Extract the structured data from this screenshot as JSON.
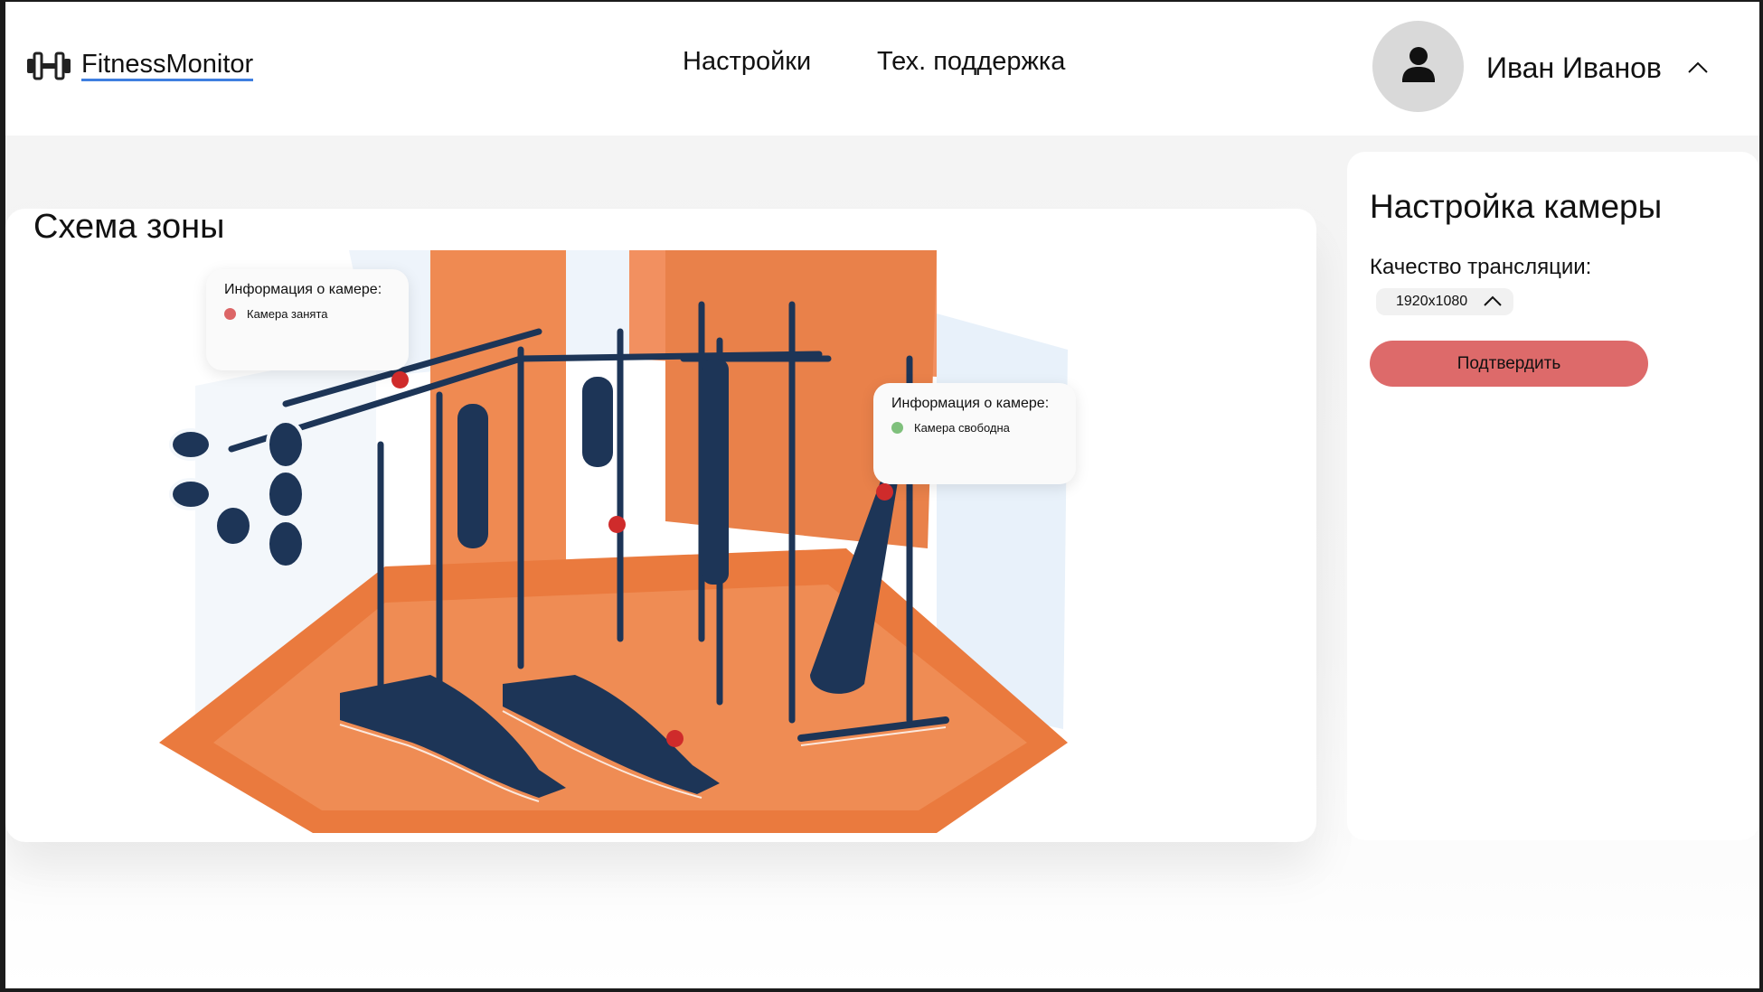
{
  "header": {
    "logo_text": "FitnessMonitor",
    "nav": [
      "Настройки",
      "Тех. поддержка"
    ],
    "user_name": "Иван Иванов"
  },
  "zone": {
    "title": "Схема зоны",
    "tooltips": [
      {
        "title": "Информация о камере:",
        "status": "Камера занята",
        "status_color": "#dc6566"
      },
      {
        "title": "Информация о камере:",
        "status": "Камера свободна",
        "status_color": "#7fc07c"
      }
    ]
  },
  "settings": {
    "title": "Настройка камеры",
    "quality_label": "Качество трансляции:",
    "quality_value": "1920x1080",
    "confirm_label": "Подтвердить"
  },
  "colors": {
    "accent": "#dd6a6a",
    "camera_marker": "#cf2b2b",
    "floor": "#ea7a3e",
    "equipment": "#1d3557"
  }
}
